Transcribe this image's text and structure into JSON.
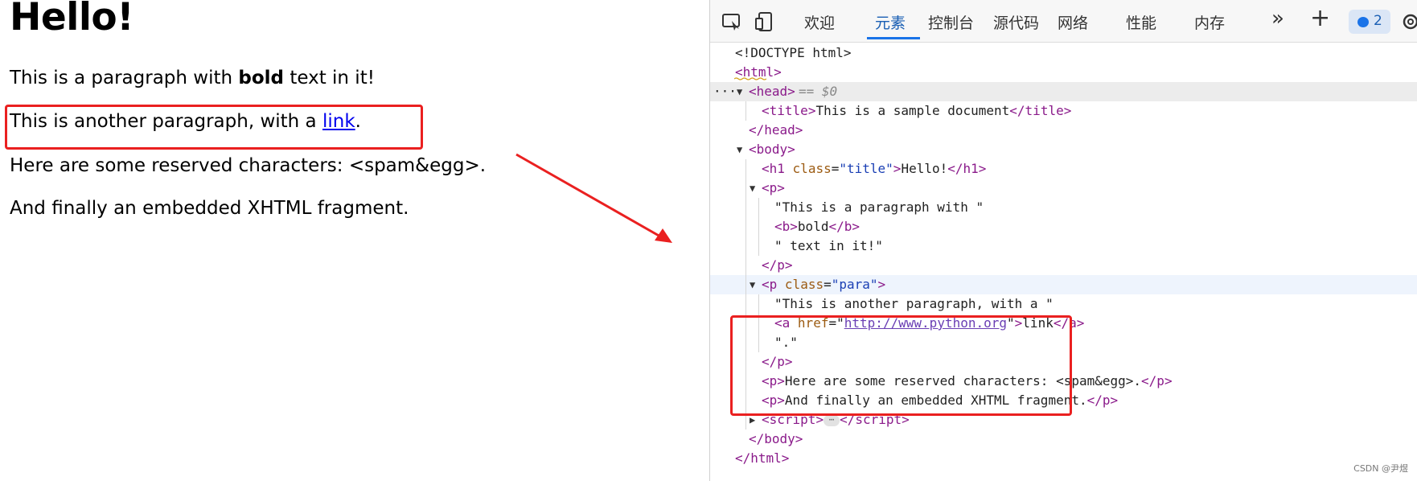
{
  "page": {
    "h1": "Hello!",
    "p1_before": "This is a paragraph with ",
    "p1_bold": "bold",
    "p1_after": " text in it!",
    "p2_before": "This is another paragraph, with a ",
    "p2_link": "link",
    "p2_after": ".",
    "p3": "Here are some reserved characters: <spam&egg>.",
    "p4": "And finally an embedded XHTML fragment."
  },
  "devtools": {
    "tabs": [
      "欢迎",
      "元素",
      "控制台",
      "源代码",
      "网络",
      "性能",
      "内存"
    ],
    "active_tab": "元素",
    "more_label": "»",
    "add_label": "+",
    "issues_count": "2",
    "tree": {
      "doctype": "<!DOCTYPE html>",
      "html_open": "html",
      "head": "head",
      "head_sel": "== $0",
      "title_tag": "title",
      "title_text": "This is a sample document",
      "body": "body",
      "h1_tag": "h1",
      "h1_attr": "class",
      "h1_val": "\"title\"",
      "h1_text": "Hello!",
      "p_tag": "p",
      "p1_t1": "\"This is a paragraph with \"",
      "b_tag": "b",
      "b_text": "bold",
      "p1_t2": "\" text in it!\"",
      "p2_attr": "class",
      "p2_val": "\"para\"",
      "p2_t1": "\"This is another paragraph, with a \"",
      "a_tag": "a",
      "a_attr": "href",
      "a_val": "http://www.python.org",
      "a_text": "link",
      "p2_t2": "\".\"",
      "p3_text": "Here are some reserved characters: <spam&egg>.",
      "p4_text": "And finally an embedded XHTML fragment.",
      "script_tag": "script",
      "ellipsis": "⋯",
      "dots": "···"
    }
  },
  "watermark": "CSDN @尹煜",
  "colors": {
    "highlight": "#ea2020",
    "link": "#0000ee",
    "tag": "#8a1a8a",
    "attr": "#9c5b12",
    "value": "#1a3fb4"
  },
  "icons": [
    "inspect-icon",
    "device-icon",
    "more-tabs-icon",
    "add-tab-icon",
    "issues-icon",
    "settings-icon"
  ]
}
